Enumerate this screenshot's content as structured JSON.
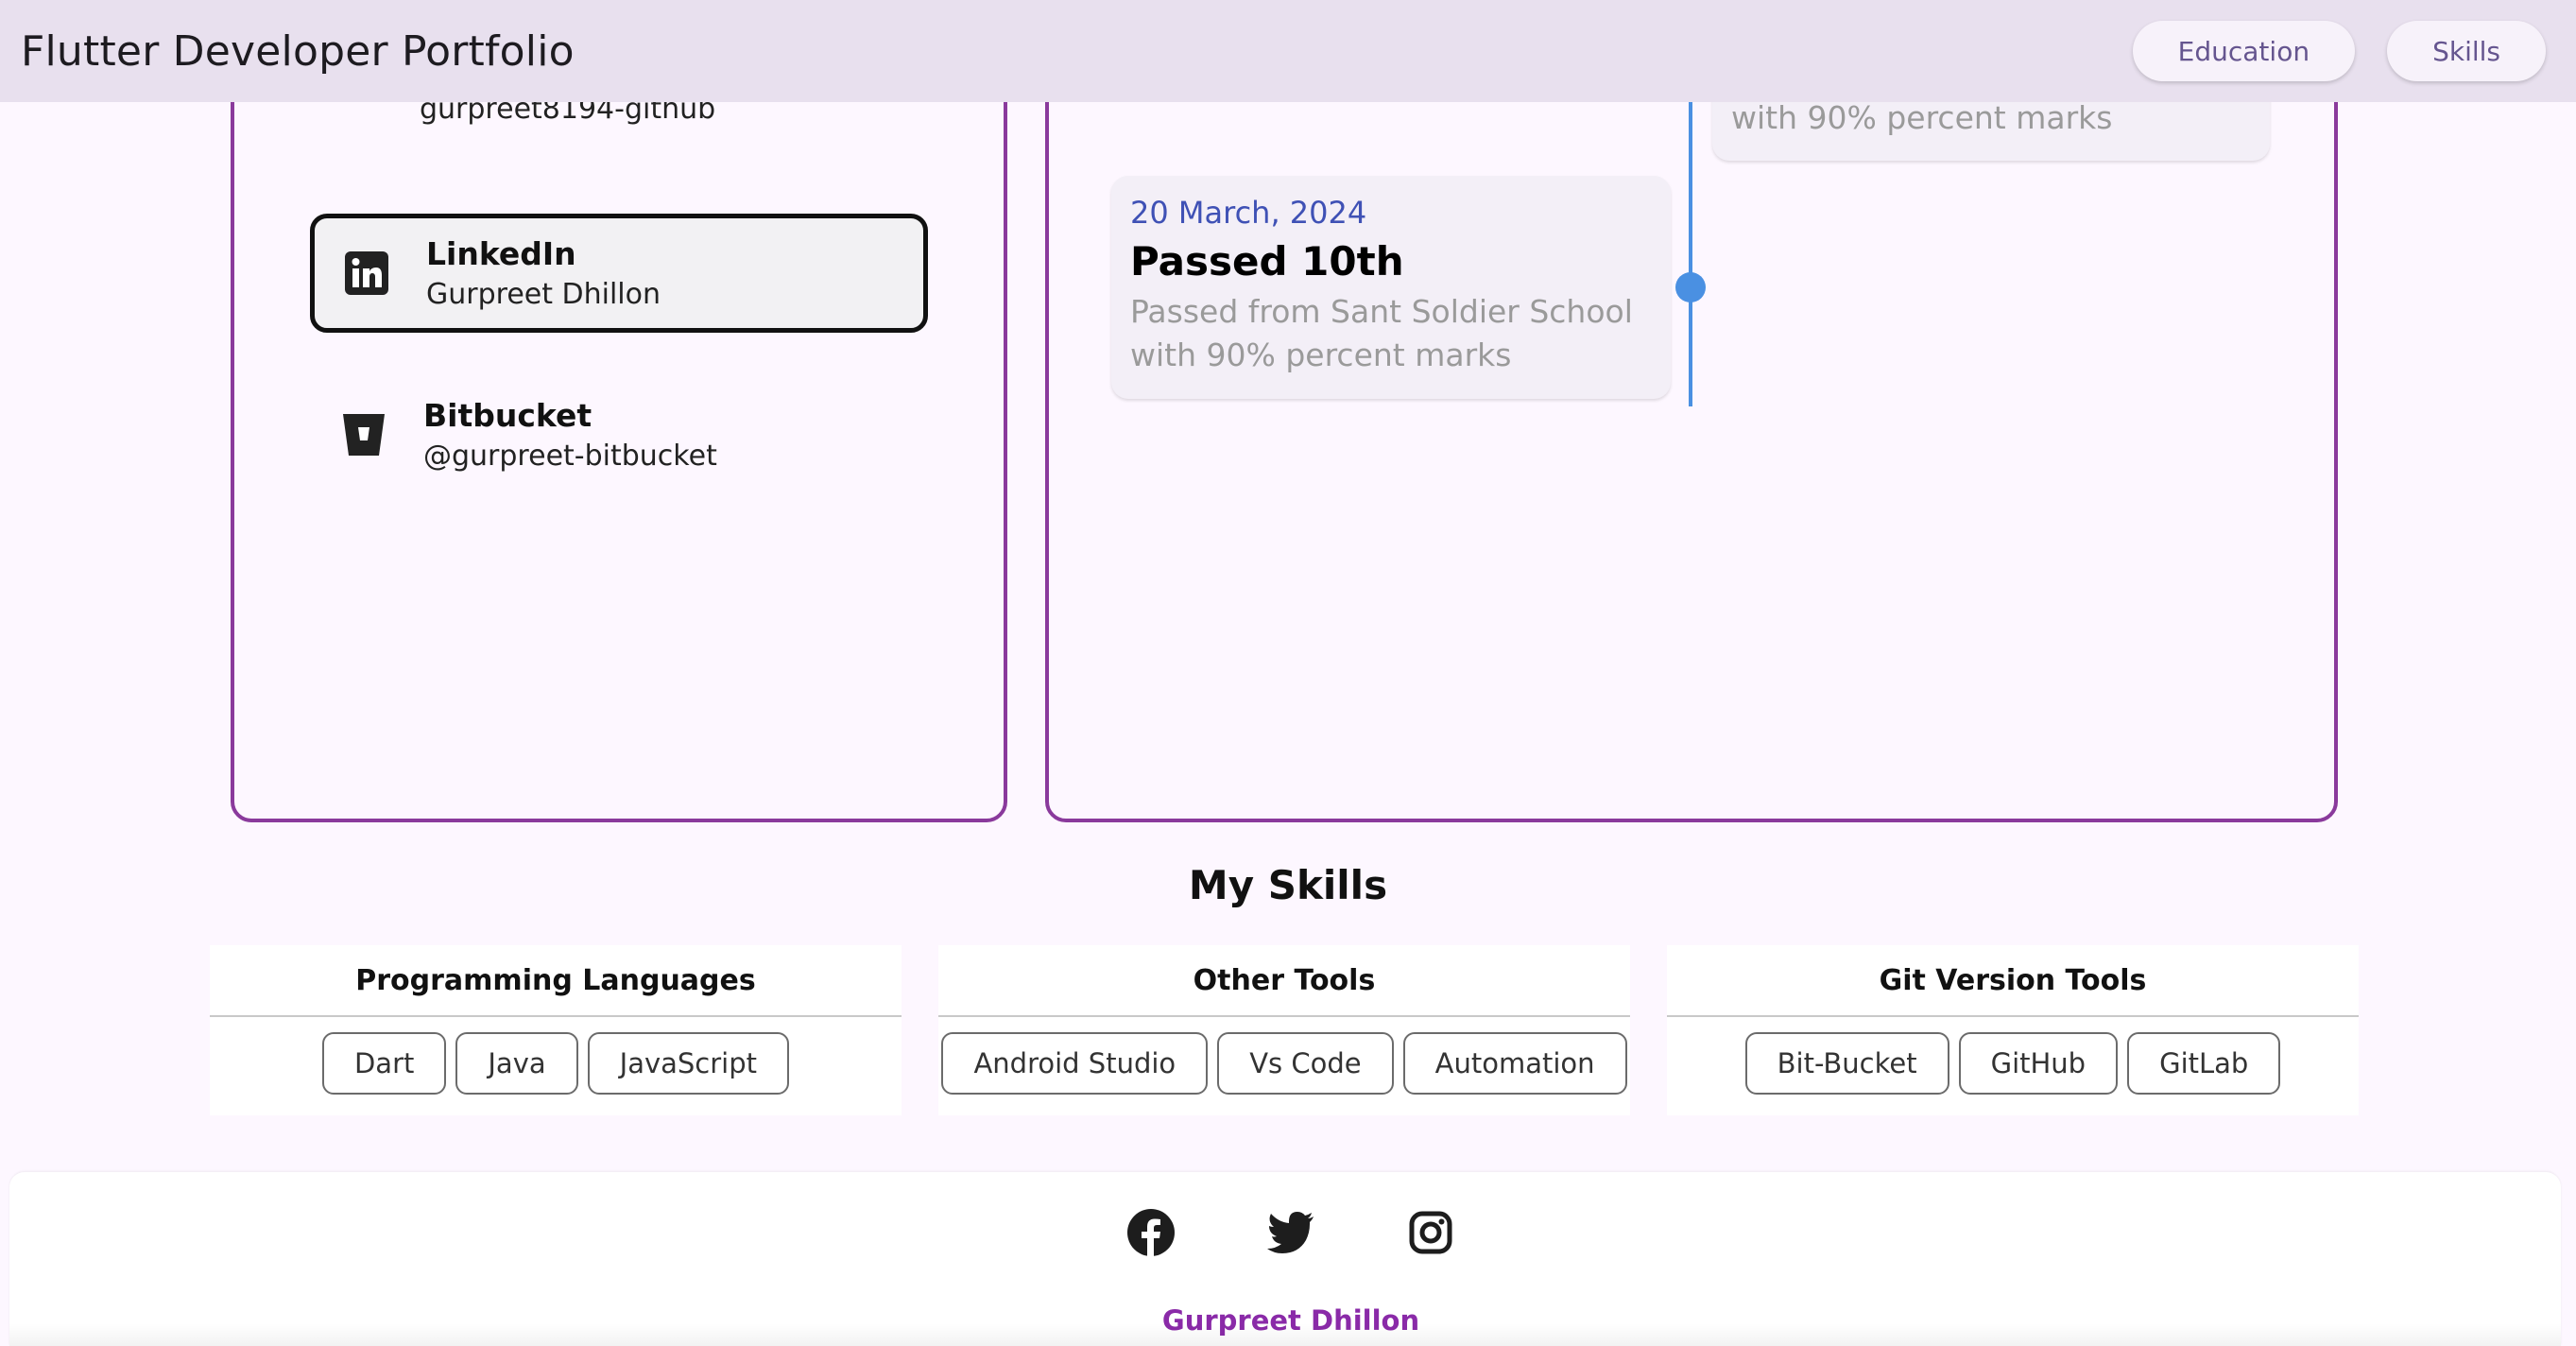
{
  "appbar": {
    "title": "Flutter Developer Portfolio",
    "actions": {
      "education": "Education",
      "skills": "Skills"
    }
  },
  "social": {
    "github": {
      "icon": "github-icon",
      "handle": "gurpreet8194-github"
    },
    "linkedin": {
      "icon": "linkedin-icon",
      "name": "LinkedIn",
      "handle": "Gurpreet Dhillon"
    },
    "bitbucket": {
      "icon": "bitbucket-icon",
      "name": "Bitbucket",
      "handle": "@gurpreet-bitbucket"
    }
  },
  "timeline": {
    "top_card": {
      "desc": "with 90% percent marks"
    },
    "main_card": {
      "date": "20 March, 2024",
      "title": "Passed 10th",
      "desc_line1": "Passed from Sant Soldier School",
      "desc_line2": "with 90% percent marks"
    }
  },
  "skills": {
    "title": "My Skills",
    "groups": [
      {
        "title": "Programming Languages",
        "items": [
          "Dart",
          "Java",
          "JavaScript"
        ]
      },
      {
        "title": "Other Tools",
        "items": [
          "Android Studio",
          "Vs Code",
          "Automation"
        ]
      },
      {
        "title": "Git Version Tools",
        "items": [
          "Bit-Bucket",
          "GitHub",
          "GitLab"
        ]
      }
    ]
  },
  "footer": {
    "icons": [
      "facebook-icon",
      "twitter-icon",
      "instagram-icon"
    ],
    "name": "Gurpreet Dhillon"
  },
  "colors": {
    "accent": "#8a3a9c",
    "appbar_bg": "#e8e0ee",
    "timeline": "#4a90e2",
    "date_text": "#3f51b5",
    "footer_name": "#8a2aa8"
  }
}
